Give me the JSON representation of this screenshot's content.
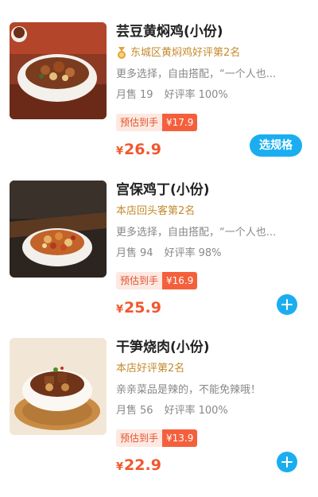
{
  "items": [
    {
      "title": "芸豆黄焖鸡(小份)",
      "rank": "东城区黄焖鸡好评第2名",
      "rank_icon": "medal-icon",
      "desc": "更多选择，自由搭配，“一个人也...",
      "monthly_sales_label": "月售",
      "monthly_sales": "19",
      "rating_label": "好评率",
      "rating": "100%",
      "estimate_label": "预估到手",
      "estimate_price": "¥17.9",
      "currency": "¥",
      "price": "26.9",
      "action": "选规格"
    },
    {
      "title": "宫保鸡丁(小份)",
      "rank": "本店回头客第2名",
      "desc": "更多选择，自由搭配，“一个人也...",
      "monthly_sales_label": "月售",
      "monthly_sales": "94",
      "rating_label": "好评率",
      "rating": "98%",
      "estimate_label": "预估到手",
      "estimate_price": "¥16.9",
      "currency": "¥",
      "price": "25.9",
      "action_icon": "plus-icon"
    },
    {
      "title": "干笋烧肉(小份)",
      "rank": "本店好评第2名",
      "desc": "亲亲菜品是辣的，不能免辣哦！",
      "monthly_sales_label": "月售",
      "monthly_sales": "56",
      "rating_label": "好评率",
      "rating": "100%",
      "estimate_label": "预估到手",
      "estimate_price": "¥13.9",
      "currency": "¥",
      "price": "22.9",
      "action_icon": "plus-icon"
    }
  ],
  "colors": {
    "price": "#f0582e",
    "rank": "#c38a2c",
    "accent_button": "#1aaef0",
    "estimate_tag": "#f4603c"
  }
}
